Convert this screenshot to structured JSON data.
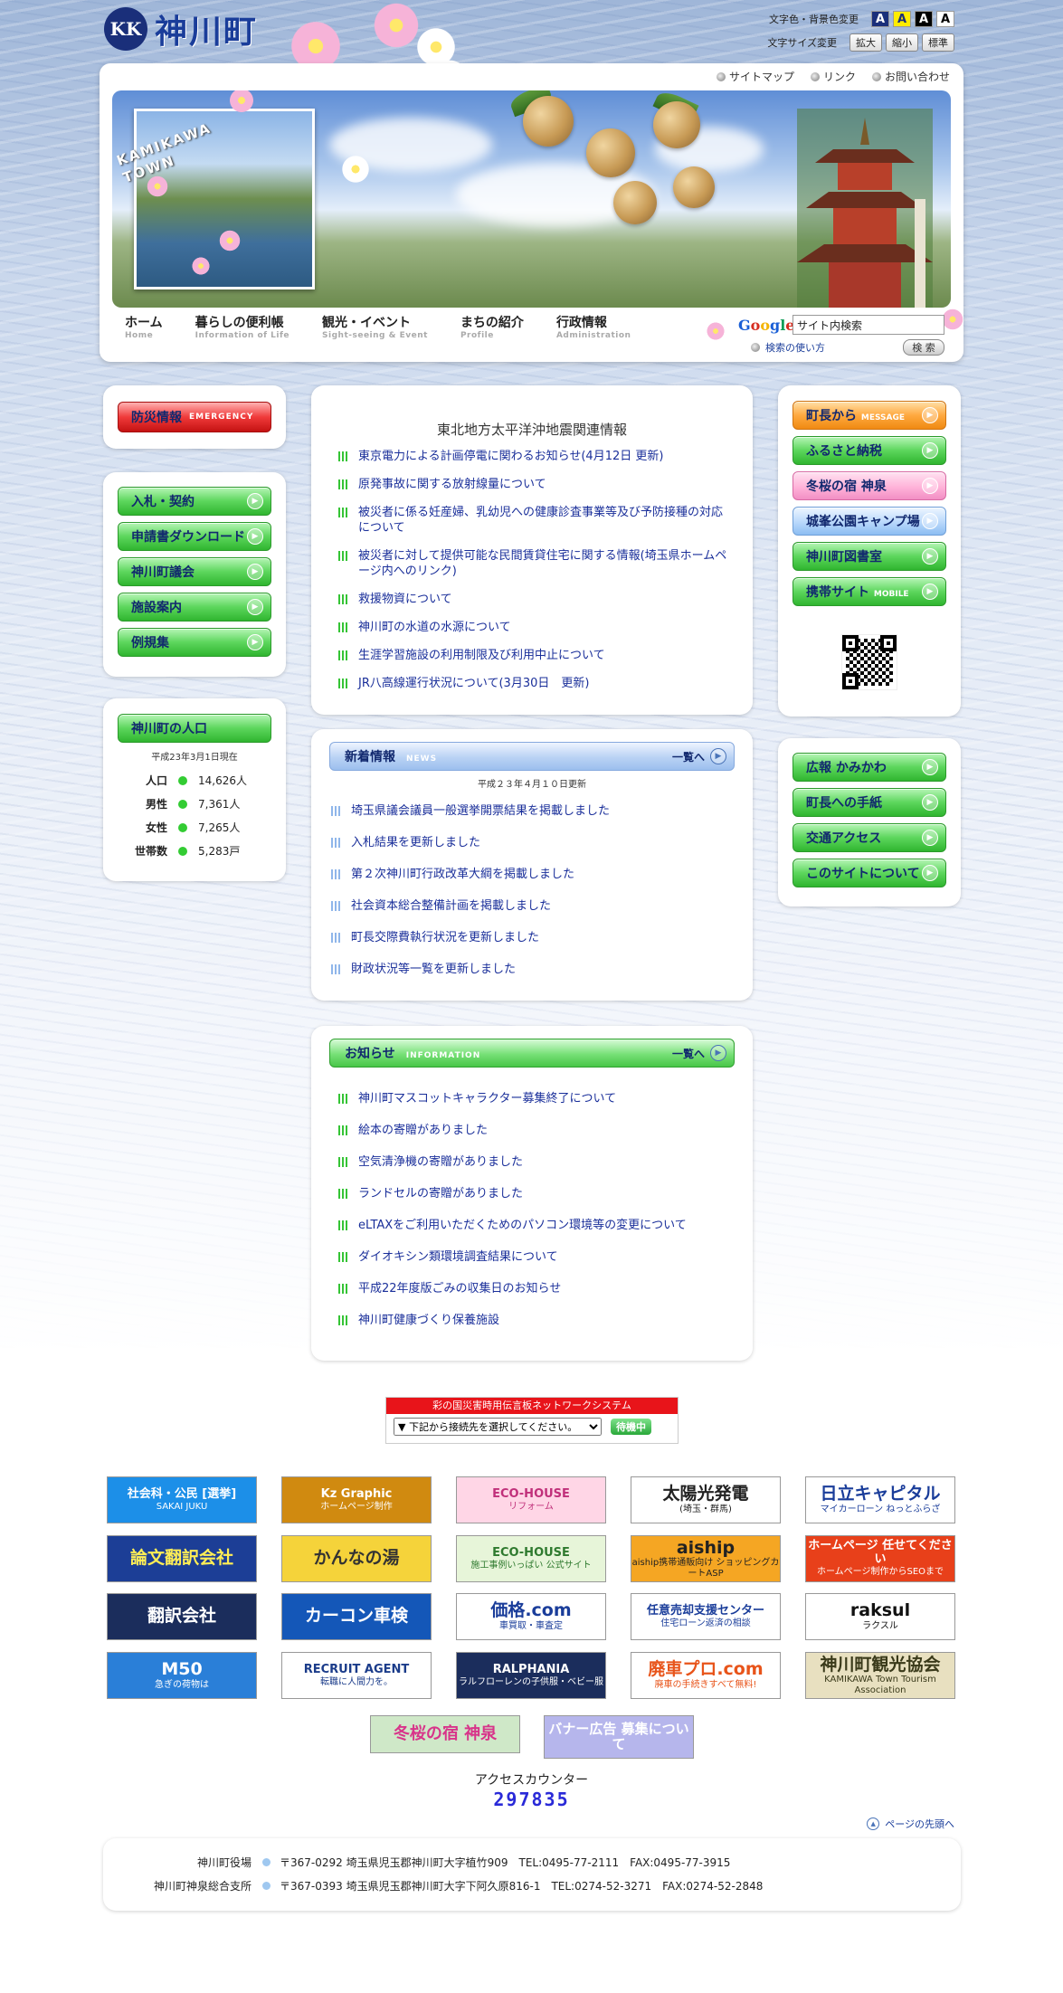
{
  "site": {
    "name": "神川町",
    "logo_mark": "KK"
  },
  "accessibility": {
    "color_label": "文字色・背景色変更",
    "size_label": "文字サイズ変更",
    "color_buttons": [
      "A",
      "A",
      "A",
      "A"
    ],
    "size_buttons": [
      "拡大",
      "縮小",
      "標準"
    ]
  },
  "top_links": [
    "サイトマップ",
    "リンク",
    "お問い合わせ"
  ],
  "hero": {
    "town_text_1": "KAMIKAWA",
    "town_text_2": "TOWN"
  },
  "nav": [
    {
      "jp": "ホーム",
      "en": "Home"
    },
    {
      "jp": "暮らしの便利帳",
      "en": "Information of Life"
    },
    {
      "jp": "観光・イベント",
      "en": "Sight-seeing & Event"
    },
    {
      "jp": "まちの紹介",
      "en": "Profile"
    },
    {
      "jp": "行政情報",
      "en": "Administration"
    }
  ],
  "search": {
    "logo": [
      "G",
      "o",
      "o",
      "g",
      "l",
      "e"
    ],
    "value": "サイト内検索",
    "howto": "検索の使い方",
    "button": "検 索"
  },
  "left": {
    "emergency": {
      "jp": "防災情報",
      "en": "EMERGENCY"
    },
    "buttons": [
      "入札・契約",
      "申請書ダウンロード",
      "神川町議会",
      "施設案内",
      "例規集"
    ],
    "population": {
      "title": "神川町の人口",
      "date": "平成23年3月1日現在",
      "rows": [
        {
          "k": "人口",
          "v": "14,626人"
        },
        {
          "k": "男性",
          "v": "7,361人"
        },
        {
          "k": "女性",
          "v": "7,265人"
        },
        {
          "k": "世帯数",
          "v": "5,283戸"
        }
      ]
    }
  },
  "quake": {
    "title": "東北地方太平洋沖地震関連情報",
    "items": [
      "東京電力による計画停電に関わるお知らせ(4月12日 更新)",
      "原発事故に関する放射線量について",
      "被災者に係る妊産婦、乳幼児への健康診査事業等及び予防接種の対応について",
      "被災者に対して提供可能な民間賃貸住宅に関する情報(埼玉県ホームページ内へのリンク)",
      "救援物資について",
      "神川町の水道の水源について",
      "生涯学習施設の利用制限及び利用中止について",
      "JR八高線運行状況について(3月30日　更新)"
    ]
  },
  "news": {
    "title": "新着情報",
    "en": "NEWS",
    "more": "一覧へ",
    "date": "平成２３年４月１０日更新",
    "items": [
      "埼玉県議会議員一般選挙開票結果を掲載しました",
      "入札結果を更新しました",
      "第２次神川町行政改革大綱を掲載しました",
      "社会資本総合整備計画を掲載しました",
      "町長交際費執行状況を更新しました",
      "財政状況等一覧を更新しました"
    ]
  },
  "info": {
    "title": "お知らせ",
    "en": "INFORMATION",
    "more": "一覧へ",
    "items": [
      "神川町マスコットキャラクター募集終了について",
      "絵本の寄贈がありました",
      "空気清浄機の寄贈がありました",
      "ランドセルの寄贈がありました",
      "eLTAXをご利用いただくためのパソコン環境等の変更について",
      "ダイオキシン類環境調査結果について",
      "平成22年度版ごみの収集日のお知らせ",
      "神川町健康づくり保養施設"
    ]
  },
  "right": {
    "buttons1": [
      {
        "label": "町長から",
        "en": "MESSAGE",
        "style": "orange"
      },
      {
        "label": "ふるさと納税",
        "en": "",
        "style": "greenb"
      },
      {
        "label": "冬桜の宿 神泉",
        "en": "",
        "style": "pink"
      },
      {
        "label": "城峯公園キャンプ場",
        "en": "",
        "style": "lblue"
      },
      {
        "label": "神川町図書室",
        "en": "",
        "style": "greenb"
      },
      {
        "label": "携帯サイト",
        "en": "MOBILE",
        "style": "greenb"
      }
    ],
    "buttons2": [
      "広報 かみかわ",
      "町長への手紙",
      "交通アクセス",
      "このサイトについて"
    ]
  },
  "disaster": {
    "title": "彩の国災害時用伝言板ネットワークシステム",
    "select": "▼ 下記から接続先を選択してください。",
    "status": "待機中"
  },
  "banners": [
    {
      "t": "社会科・公民 [選挙]",
      "s": "SAKAI JUKU",
      "bg": "#1c8fe8",
      "fg": "#ffffff"
    },
    {
      "t": "Kz Graphic",
      "s": "ホームページ制作",
      "bg": "#d08a10",
      "fg": "#ffffff"
    },
    {
      "t": "ECO-HOUSE",
      "s": "リフォーム",
      "bg": "#ffd6e6",
      "fg": "#c0307a"
    },
    {
      "t": "太陽光発電",
      "s": "(埼玉・群馬)",
      "bg": "#ffffff",
      "fg": "#222222"
    },
    {
      "t": "日立キャピタル",
      "s": "マイカーローン ねっとふらざ",
      "bg": "#ffffff",
      "fg": "#1a3d9a"
    },
    {
      "t": "論文翻訳会社",
      "s": "",
      "bg": "#1c3e96",
      "fg": "#ffee55"
    },
    {
      "t": "かんなの湯",
      "s": "",
      "bg": "#f5d33a",
      "fg": "#333333"
    },
    {
      "t": "ECO-HOUSE",
      "s": "施工事例いっぱい 公式サイト",
      "bg": "#e7f5d9",
      "fg": "#2f7a2f"
    },
    {
      "t": "aiship",
      "s": "aiship携帯通販向け ショッピングカートASP",
      "bg": "#f5a623",
      "fg": "#222222"
    },
    {
      "t": "ホームページ 任せてください",
      "s": "ホームページ制作からSEOまで",
      "bg": "#e8401a",
      "fg": "#ffffff"
    },
    {
      "t": "翻訳会社",
      "s": "",
      "bg": "#1b2d5c",
      "fg": "#ffffff"
    },
    {
      "t": "カーコン車検",
      "s": "",
      "bg": "#1457b8",
      "fg": "#ffffff"
    },
    {
      "t": "価格.com",
      "s": "車買取・車査定",
      "bg": "#ffffff",
      "fg": "#1a3d9a"
    },
    {
      "t": "任意売却支援センター",
      "s": "住宅ローン返済の相談",
      "bg": "#ffffff",
      "fg": "#1a3d9a"
    },
    {
      "t": "raksul",
      "s": "ラクスル",
      "bg": "#ffffff",
      "fg": "#111111"
    },
    {
      "t": "M50",
      "s": "急ぎの荷物は",
      "bg": "#2a7fd8",
      "fg": "#ffffff"
    },
    {
      "t": "RECRUIT AGENT",
      "s": "転職に人間力を。",
      "bg": "#ffffff",
      "fg": "#1b3c8a"
    },
    {
      "t": "RALPHANIA",
      "s": "ラルフローレンの子供服・ベビー服",
      "bg": "#1b2d5c",
      "fg": "#ffffff"
    },
    {
      "t": "廃車プロ.com",
      "s": "廃車の手続きすべて無料!",
      "bg": "#ffffff",
      "fg": "#e8541a"
    },
    {
      "t": "神川町観光協会",
      "s": "KAMIKAWA Town Tourism Association",
      "bg": "#e8e0c0",
      "fg": "#3a3a1a"
    }
  ],
  "banners_bottom": [
    {
      "t": "冬桜の宿 神泉",
      "bg": "#cfe8c8",
      "fg": "#d8348a"
    },
    {
      "t": "バナー広告 募集について",
      "bg": "#b6b6ec",
      "fg": "#ffffff"
    }
  ],
  "counter": {
    "label": "アクセスカウンター",
    "value": "297835"
  },
  "pagetop": "ページの先頭へ",
  "footer": [
    {
      "name": "神川町役場",
      "detail": "〒367-0292 埼玉県児玉郡神川町大字植竹909　TEL:0495-77-2111　FAX:0495-77-3915"
    },
    {
      "name": "神川町神泉総合支所",
      "detail": "〒367-0393 埼玉県児玉郡神川町大字下阿久原816-1　TEL:0274-52-3271　FAX:0274-52-2848"
    }
  ]
}
